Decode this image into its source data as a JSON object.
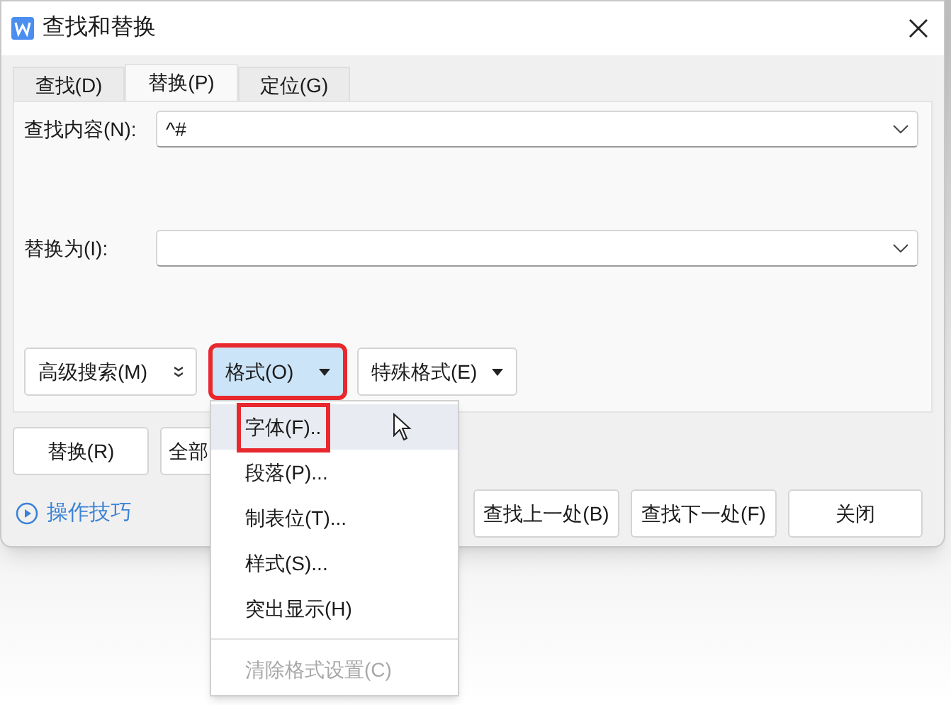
{
  "window": {
    "title": "查找和替换"
  },
  "tabs": [
    {
      "label": "查找(D)",
      "selected": false
    },
    {
      "label": "替换(P)",
      "selected": true
    },
    {
      "label": "定位(G)",
      "selected": false
    }
  ],
  "fields": [
    {
      "label": "查找内容(N):",
      "value": "^#"
    },
    {
      "label": "替换为(I):"
    }
  ],
  "option_buttons": [
    {
      "label": "高级搜索(M)",
      "kind": "expand",
      "pressed": false,
      "highlighted": false
    },
    {
      "label": "格式(O)",
      "kind": "dropdown",
      "pressed": true,
      "highlighted": true
    },
    {
      "label": "特殊格式(E)",
      "kind": "dropdown",
      "pressed": false,
      "highlighted": false
    }
  ],
  "action_buttons": [
    {
      "label": "替换(R)"
    },
    {
      "label": "全部"
    }
  ],
  "tips_link": {
    "label": "操作技巧"
  },
  "nav_buttons": [
    {
      "label": "查找上一处(B)"
    },
    {
      "label": "查找下一处(F)"
    },
    {
      "label": "关闭"
    }
  ],
  "format_menu": {
    "items": [
      {
        "kind": "item",
        "label": "字体(F)..",
        "hovered": true,
        "highlighted": true,
        "disabled": false
      },
      {
        "kind": "item",
        "label": "段落(P)...",
        "hovered": false,
        "highlighted": false,
        "disabled": false
      },
      {
        "kind": "item",
        "label": "制表位(T)...",
        "hovered": false,
        "highlighted": false,
        "disabled": false
      },
      {
        "kind": "item",
        "label": "样式(S)...",
        "hovered": false,
        "highlighted": false,
        "disabled": false
      },
      {
        "kind": "item",
        "label": "突出显示(H)",
        "hovered": false,
        "highlighted": false,
        "disabled": false
      },
      {
        "kind": "separator"
      },
      {
        "kind": "item",
        "label": "清除格式设置(C)",
        "hovered": false,
        "highlighted": false,
        "disabled": true
      }
    ]
  }
}
